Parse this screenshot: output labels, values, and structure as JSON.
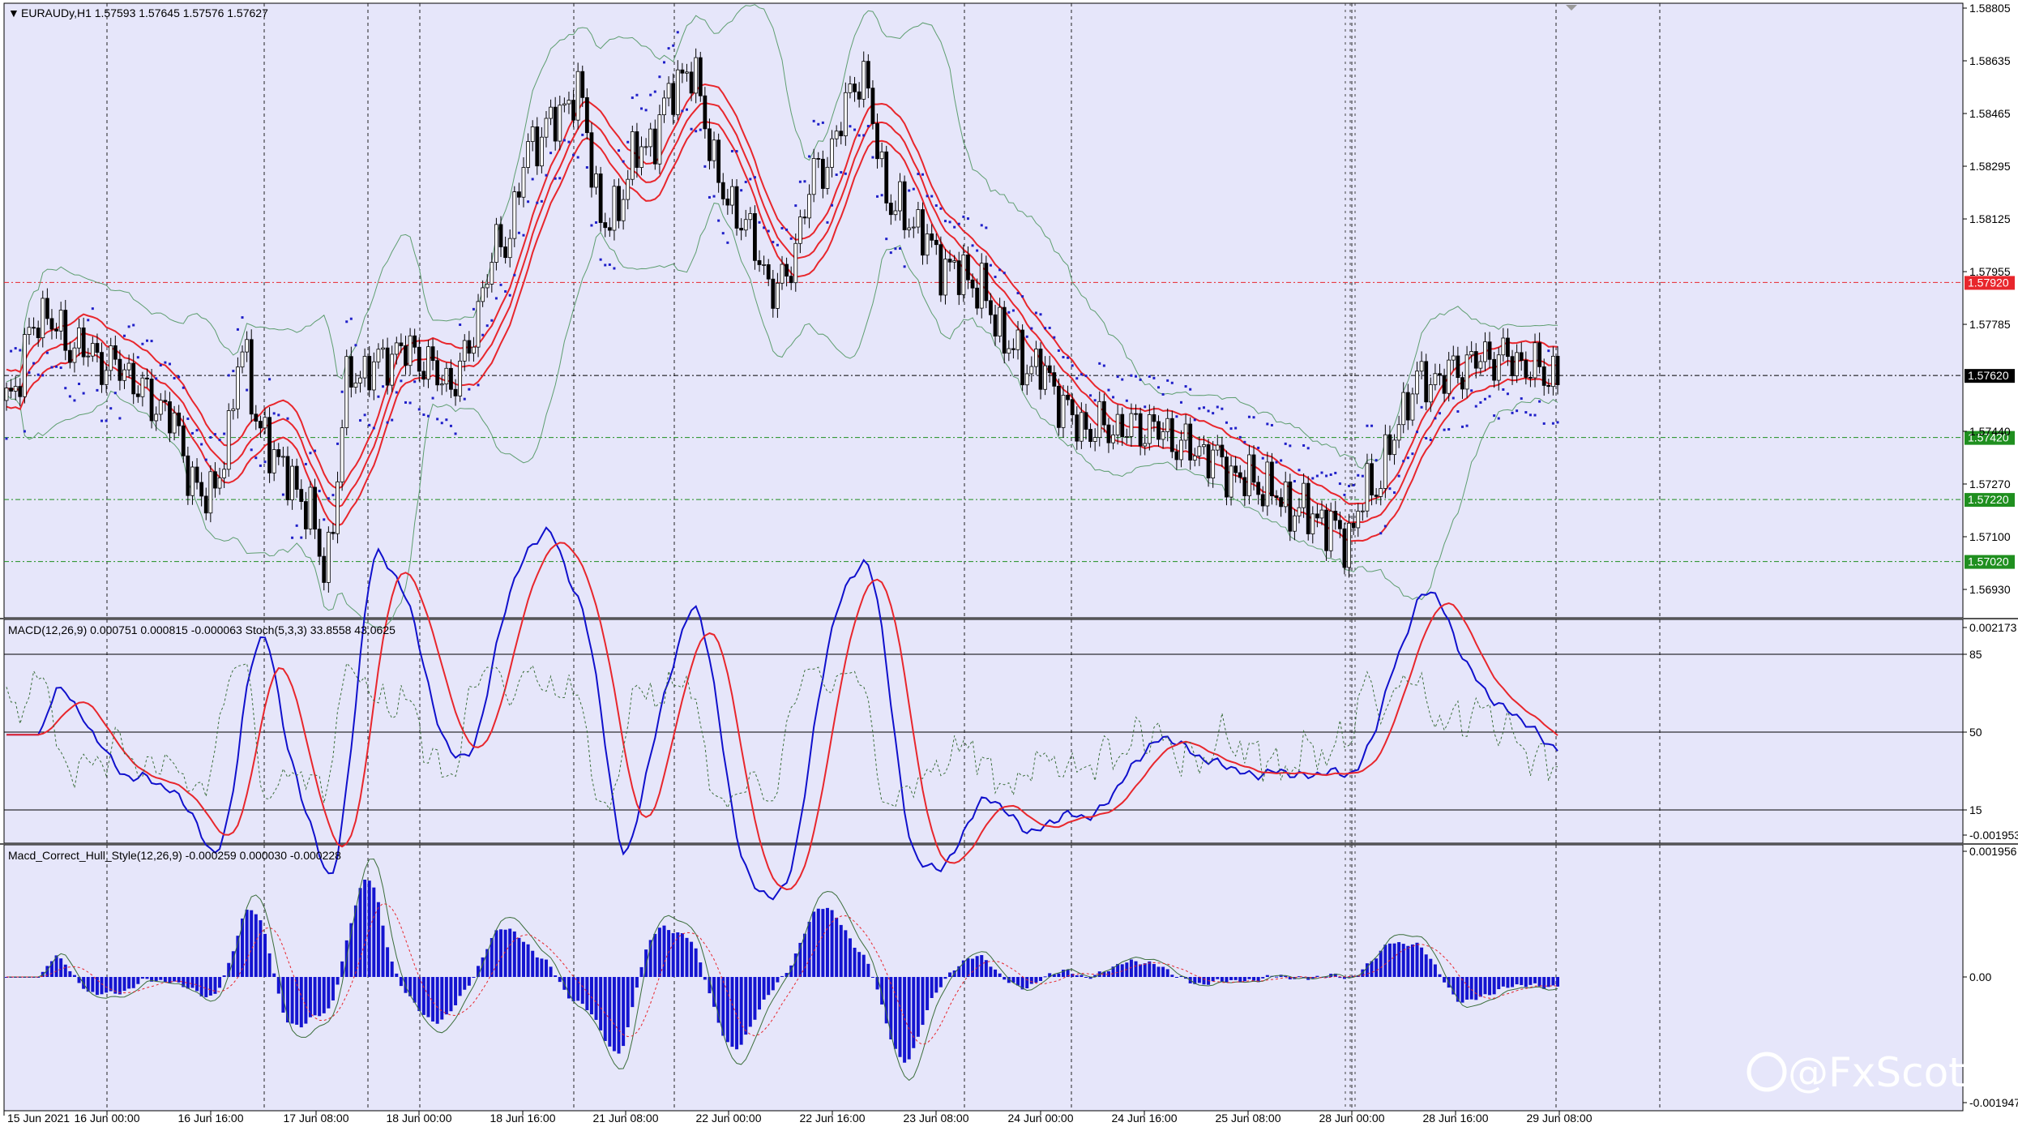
{
  "price_panel": {
    "header": "EURAUDy,H1  1.57593 1.57645 1.57576 1.57627",
    "axis_labels": [
      "1.58805",
      "1.58635",
      "1.58465",
      "1.58295",
      "1.58125",
      "1.57955",
      "1.57785",
      "1.57440",
      "1.57270",
      "1.57100",
      "1.56930"
    ],
    "levels": [
      {
        "value": "1.57920",
        "color": "#e8262c"
      },
      {
        "value": "1.57620",
        "color": "#000000"
      },
      {
        "value": "1.57420",
        "color": "#1f8f1f"
      },
      {
        "value": "1.57220",
        "color": "#1f8f1f"
      },
      {
        "value": "1.57020",
        "color": "#1f8f1f"
      }
    ]
  },
  "macd_panel": {
    "header": "MACD(12,26,9) 0.000751 0.000815 -0.000063  Stoch(5,3,3) 33.8558 43.0625",
    "axis_labels": [
      "0.002173",
      "85",
      "50",
      "15",
      "-0.001953"
    ]
  },
  "hull_panel": {
    "header": "Macd_Correct_Hull_Style(12,26,9) -0.000259 0.000030 -0.000228",
    "axis_labels": [
      "0.001956",
      "0.00",
      "-0.001947"
    ]
  },
  "time_axis": [
    "15 Jun 2021",
    "16 Jun 00:00",
    "16 Jun 16:00",
    "17 Jun 08:00",
    "18 Jun 00:00",
    "18 Jun 16:00",
    "21 Jun 08:00",
    "22 Jun 00:00",
    "22 Jun 16:00",
    "23 Jun 08:00",
    "24 Jun 00:00",
    "24 Jun 16:00",
    "25 Jun 08:00",
    "28 Jun 00:00",
    "28 Jun 16:00",
    "29 Jun 08:00"
  ],
  "watermark": "@FxScotty",
  "colors": {
    "background": "#e6e6fa",
    "bull": "#ffffff",
    "bear": "#000000",
    "envelope": "#e8262c",
    "bollinger": "#5e9e70",
    "sar": "#1f1fc8",
    "macd": "#1010cc",
    "signal": "#e8262c",
    "stoch": "#3b6e3b",
    "hist": "#1414d0"
  }
}
